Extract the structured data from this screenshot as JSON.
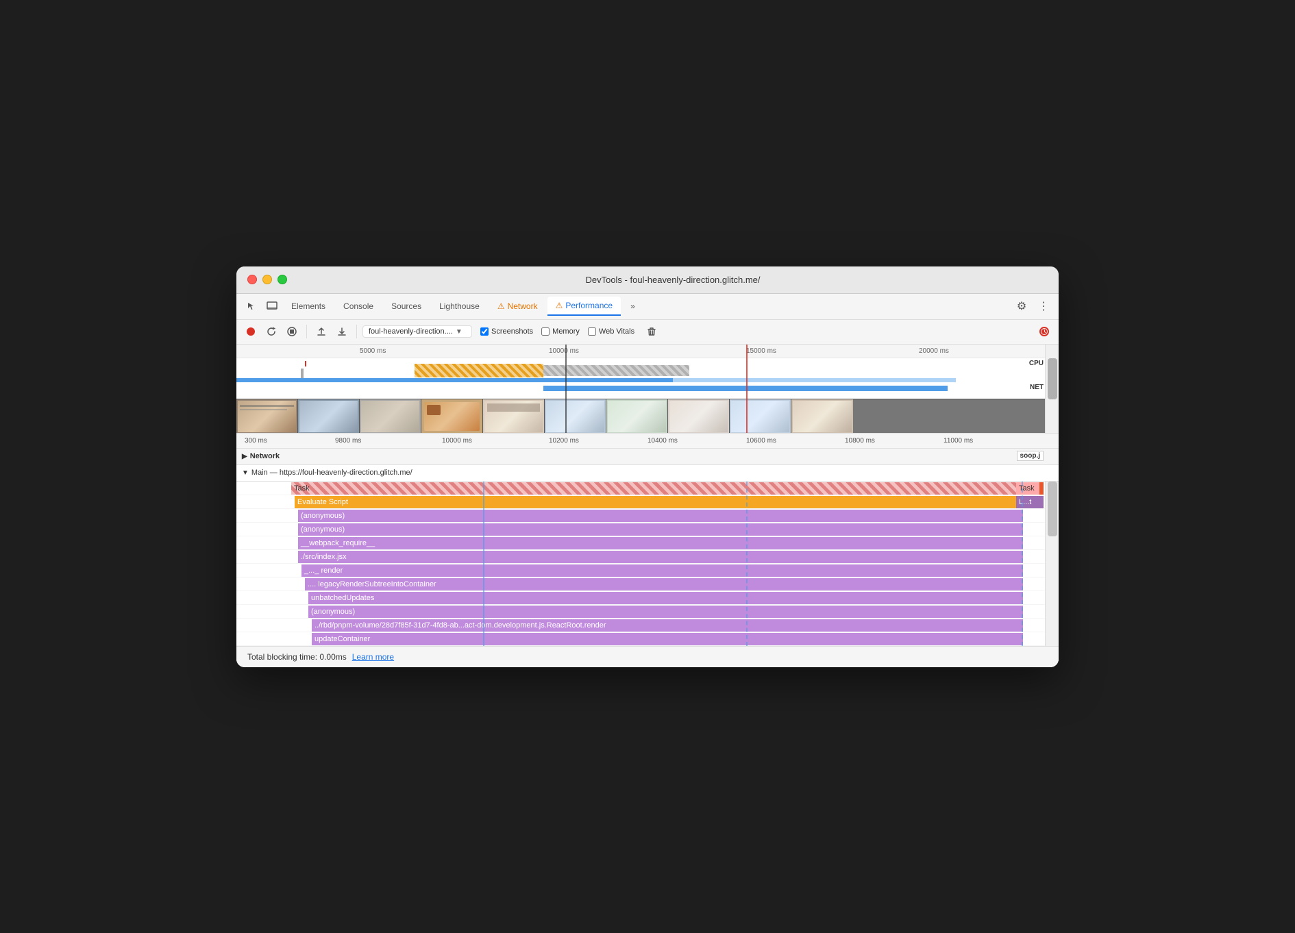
{
  "window": {
    "title": "DevTools - foul-heavenly-direction.glitch.me/"
  },
  "tabs": {
    "items": [
      {
        "id": "elements",
        "label": "Elements",
        "active": false,
        "warning": false
      },
      {
        "id": "console",
        "label": "Console",
        "active": false,
        "warning": false
      },
      {
        "id": "sources",
        "label": "Sources",
        "active": false,
        "warning": false
      },
      {
        "id": "lighthouse",
        "label": "Lighthouse",
        "active": false,
        "warning": false
      },
      {
        "id": "network",
        "label": "Network",
        "active": false,
        "warning": true
      },
      {
        "id": "performance",
        "label": "Performance",
        "active": true,
        "warning": true
      },
      {
        "id": "overflow",
        "label": "»",
        "active": false,
        "warning": false
      }
    ]
  },
  "toolbar": {
    "url_value": "foul-heavenly-direction....",
    "screenshots_label": "Screenshots",
    "memory_label": "Memory",
    "web_vitals_label": "Web Vitals",
    "screenshots_checked": true,
    "memory_checked": false,
    "web_vitals_checked": false
  },
  "timeline": {
    "ruler_marks": [
      "5000 ms",
      "10000 ms",
      "15000 ms",
      "20000 ms"
    ],
    "cpu_label": "CPU",
    "net_label": "NET",
    "detail_marks": [
      "300 ms",
      "9800 ms",
      "10000 ms",
      "10200 ms",
      "10400 ms",
      "10600 ms",
      "10800 ms",
      "11000 ms"
    ]
  },
  "network_section": {
    "label": "Network",
    "badge": "soop.j"
  },
  "main_section": {
    "label": "Main — https://foul-heavenly-direction.glitch.me/"
  },
  "flame_rows": [
    {
      "id": "task",
      "label": "Task",
      "indent": 0,
      "color": "task",
      "right_label": "Task"
    },
    {
      "id": "evaluate",
      "label": "Evaluate Script",
      "indent": 1,
      "color": "evaluate",
      "right_label": "L...t"
    },
    {
      "id": "anon1",
      "label": "(anonymous)",
      "indent": 2,
      "color": "purple"
    },
    {
      "id": "anon2",
      "label": "(anonymous)",
      "indent": 2,
      "color": "purple"
    },
    {
      "id": "webpack",
      "label": "__webpack_require__",
      "indent": 2,
      "color": "purple"
    },
    {
      "id": "srcindex",
      "label": "./src/index.jsx",
      "indent": 2,
      "color": "purple"
    },
    {
      "id": "render",
      "label": "_..._ render",
      "indent": 3,
      "color": "purple"
    },
    {
      "id": "legacy",
      "label": "....  legacyRenderSubtreeIntoContainer",
      "indent": 4,
      "color": "purple"
    },
    {
      "id": "unbatched",
      "label": "unbatchedUpdates",
      "indent": 5,
      "color": "purple"
    },
    {
      "id": "anon3",
      "label": "(anonymous)",
      "indent": 5,
      "color": "purple"
    },
    {
      "id": "rbd",
      "label": "../rbd/pnpm-volume/28d7f85f-31d7-4fd8-ab...act-dom.development.js.ReactRoot.render",
      "indent": 6,
      "color": "purple"
    },
    {
      "id": "update",
      "label": "updateContainer",
      "indent": 6,
      "color": "purple"
    }
  ],
  "status_bar": {
    "text": "Total blocking time: 0.00ms",
    "learn_more": "Learn more"
  }
}
